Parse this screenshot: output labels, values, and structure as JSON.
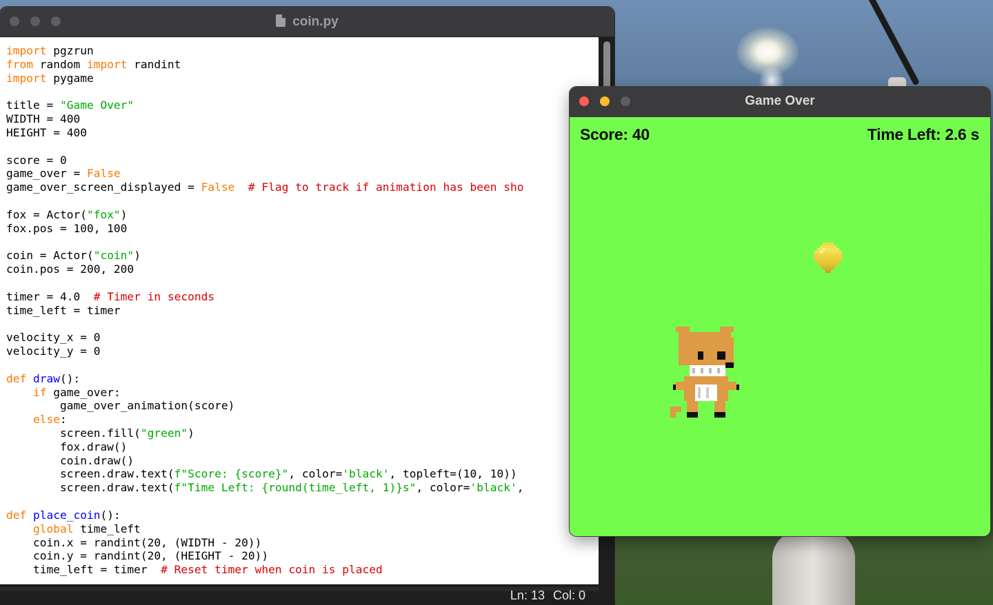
{
  "editor": {
    "filename": "coin.py",
    "status": {
      "line": "Ln: 13",
      "col": "Col: 0"
    },
    "code": [
      [
        {
          "t": "import",
          "c": "kw"
        },
        {
          "t": " pgzrun"
        }
      ],
      [
        {
          "t": "from",
          "c": "kw"
        },
        {
          "t": " random "
        },
        {
          "t": "import",
          "c": "kw"
        },
        {
          "t": " randint"
        }
      ],
      [
        {
          "t": "import",
          "c": "kw"
        },
        {
          "t": " pygame"
        }
      ],
      [],
      [
        {
          "t": "title = "
        },
        {
          "t": "\"Game Over\"",
          "c": "str"
        }
      ],
      [
        {
          "t": "WIDTH = 400"
        }
      ],
      [
        {
          "t": "HEIGHT = 400"
        }
      ],
      [],
      [
        {
          "t": "score = 0"
        }
      ],
      [
        {
          "t": "game_over = "
        },
        {
          "t": "False",
          "c": "kw"
        }
      ],
      [
        {
          "t": "game_over_screen_displayed = "
        },
        {
          "t": "False",
          "c": "kw"
        },
        {
          "t": "  "
        },
        {
          "t": "# Flag to track if animation has been sho",
          "c": "com"
        }
      ],
      [],
      [
        {
          "t": "fox = Actor("
        },
        {
          "t": "\"fox\"",
          "c": "str"
        },
        {
          "t": ")"
        }
      ],
      [
        {
          "t": "fox.pos = 100, 100"
        }
      ],
      [],
      [
        {
          "t": "coin = Actor("
        },
        {
          "t": "\"coin\"",
          "c": "str"
        },
        {
          "t": ")"
        }
      ],
      [
        {
          "t": "coin.pos = 200, 200"
        }
      ],
      [],
      [
        {
          "t": "timer = 4.0  "
        },
        {
          "t": "# Timer in seconds",
          "c": "com"
        }
      ],
      [
        {
          "t": "time_left = timer"
        }
      ],
      [],
      [
        {
          "t": "velocity_x = 0"
        }
      ],
      [
        {
          "t": "velocity_y = 0"
        }
      ],
      [],
      [
        {
          "t": "def",
          "c": "kw"
        },
        {
          "t": " "
        },
        {
          "t": "draw",
          "c": "fn"
        },
        {
          "t": "():"
        }
      ],
      [
        {
          "t": "    "
        },
        {
          "t": "if",
          "c": "kw"
        },
        {
          "t": " game_over:"
        }
      ],
      [
        {
          "t": "        game_over_animation(score)"
        }
      ],
      [
        {
          "t": "    "
        },
        {
          "t": "else",
          "c": "kw"
        },
        {
          "t": ":"
        }
      ],
      [
        {
          "t": "        screen.fill("
        },
        {
          "t": "\"green\"",
          "c": "str"
        },
        {
          "t": ")"
        }
      ],
      [
        {
          "t": "        fox.draw()"
        }
      ],
      [
        {
          "t": "        coin.draw()"
        }
      ],
      [
        {
          "t": "        screen.draw.text("
        },
        {
          "t": "f\"Score: {score}\"",
          "c": "str"
        },
        {
          "t": ", color="
        },
        {
          "t": "'black'",
          "c": "str"
        },
        {
          "t": ", topleft=(10, 10))"
        }
      ],
      [
        {
          "t": "        screen.draw.text("
        },
        {
          "t": "f\"Time Left: {round(time_left, 1)}s\"",
          "c": "str"
        },
        {
          "t": ", color="
        },
        {
          "t": "'black'",
          "c": "str"
        },
        {
          "t": ","
        }
      ],
      [],
      [
        {
          "t": "def",
          "c": "kw"
        },
        {
          "t": " "
        },
        {
          "t": "place_coin",
          "c": "fn"
        },
        {
          "t": "():"
        }
      ],
      [
        {
          "t": "    "
        },
        {
          "t": "global",
          "c": "kw"
        },
        {
          "t": " time_left"
        }
      ],
      [
        {
          "t": "    coin.x = randint(20, (WIDTH - 20))"
        }
      ],
      [
        {
          "t": "    coin.y = randint(20, (HEIGHT - 20))"
        }
      ],
      [
        {
          "t": "    time_left = timer  "
        },
        {
          "t": "# Reset timer when coin is placed",
          "c": "com"
        }
      ]
    ]
  },
  "game": {
    "window_title": "Game Over",
    "score_label": "Score: 40",
    "time_label": "Time Left: 2.6 s",
    "background_color": "#74fc4c"
  },
  "colors": {
    "keyword": "#ff7700",
    "string": "#00aa00",
    "comment": "#dd0000",
    "function": "#0000ff",
    "close": "#ff5f57",
    "minimize": "#febc2e",
    "inactive": "#5e5e60"
  }
}
